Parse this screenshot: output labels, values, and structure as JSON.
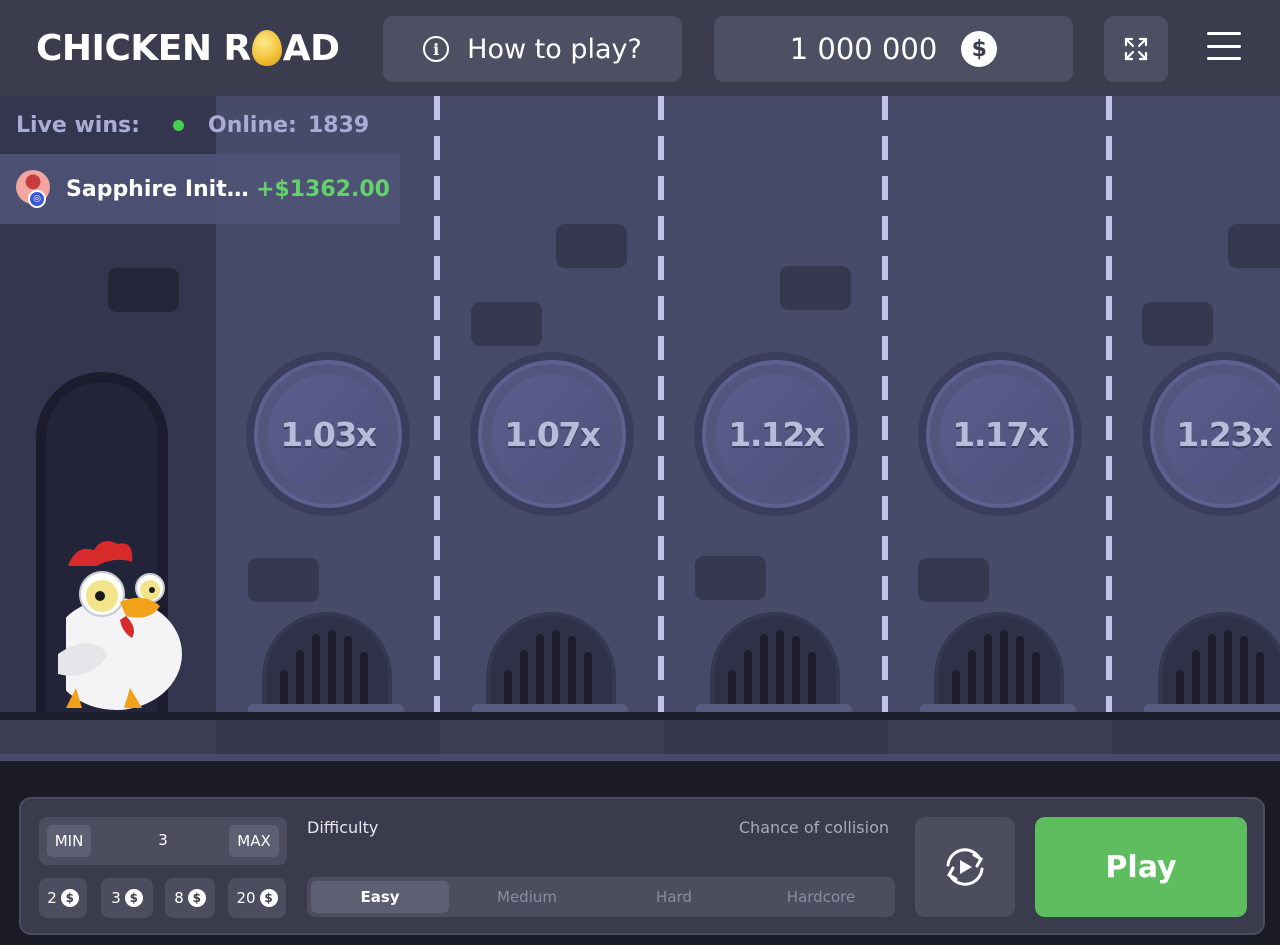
{
  "header": {
    "logo_left": "CHICKEN R",
    "logo_right": "AD",
    "how_to_play": "How to play?",
    "balance": "1 000 000",
    "currency_symbol": "$",
    "info_glyph": "i"
  },
  "live": {
    "label": "Live wins:",
    "online_label": "Online:",
    "online_count": "1839",
    "online_status_color": "#43d14f",
    "latest_win": {
      "name": "Sapphire Init…",
      "amount": "+$1362.00"
    }
  },
  "lanes": [
    {
      "multiplier": "1.03x"
    },
    {
      "multiplier": "1.07x"
    },
    {
      "multiplier": "1.12x"
    },
    {
      "multiplier": "1.17x"
    },
    {
      "multiplier": "1.23x"
    }
  ],
  "controls": {
    "min_label": "MIN",
    "max_label": "MAX",
    "bet_value": "3",
    "quick_bets": [
      "2",
      "3",
      "8",
      "20"
    ],
    "chip_symbol": "$",
    "difficulty_label": "Difficulty",
    "chance_label": "Chance of collision",
    "difficulties": [
      "Easy",
      "Medium",
      "Hard",
      "Hardcore"
    ],
    "selected_difficulty": "Easy",
    "play_label": "Play",
    "play_color": "#5ebe5f"
  }
}
